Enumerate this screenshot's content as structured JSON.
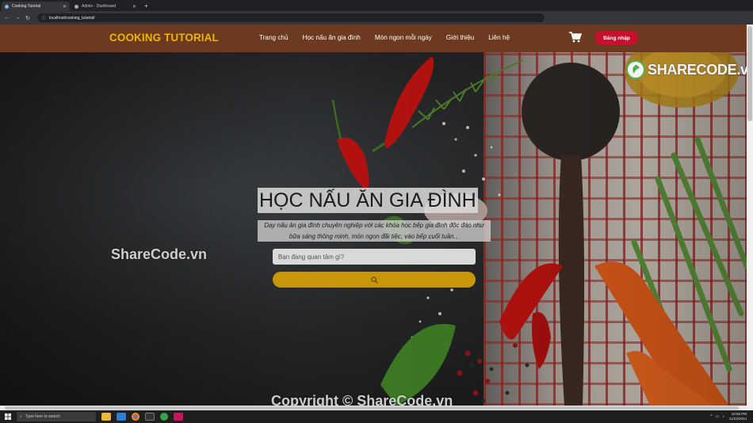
{
  "browser": {
    "tabs": [
      {
        "title": "Cooking Tutorial",
        "active": true
      },
      {
        "title": "Admin - Dashboard",
        "active": false
      }
    ],
    "new_tab": "+",
    "url": "localhost/cooking_tutorial/"
  },
  "header": {
    "logo": "COOKING TUTORIAL",
    "nav": [
      "Trang chủ",
      "Học nấu ăn gia đình",
      "Món ngon mỗi ngày",
      "Giới thiệu",
      "Liên hệ"
    ],
    "cart_icon": "cart-icon",
    "login_label": "Đăng nhập"
  },
  "hero": {
    "title": "HỌC NẤU ĂN GIA ĐÌNH",
    "description": "Dạy nấu ăn gia đình chuyên nghiệp với các khóa học bếp gia đình độc đáo như bữa sáng thông minh, món ngon đãi tiệc, vào bếp cuối tuần...",
    "search_placeholder": "Bạn đang quan tâm gì?",
    "search_icon": "search-icon"
  },
  "watermarks": {
    "left": "ShareCode.vn",
    "bottom": "Copyright © ShareCode.vn",
    "logo": "SHARECODE.vn"
  },
  "taskbar": {
    "search_placeholder": "Type here to search",
    "time": "10:56 PM",
    "date": "11/24/2024"
  },
  "colors": {
    "header_bg": "#6b3a1f",
    "logo": "#f0b400",
    "login_bg": "#c8102e",
    "search_button": "#c8960a"
  }
}
